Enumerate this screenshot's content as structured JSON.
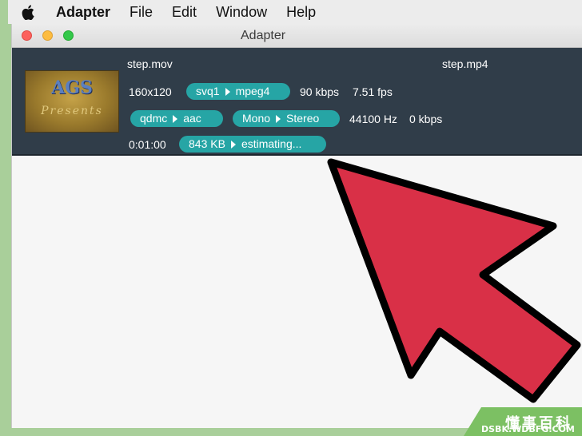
{
  "menubar": {
    "apple_icon": "apple-logo-icon",
    "app_name": "Adapter",
    "items": [
      "File",
      "Edit",
      "Window",
      "Help"
    ]
  },
  "window": {
    "title": "Adapter"
  },
  "job": {
    "thumbnail": {
      "logo_top": "AGS",
      "logo_bottom": "Presents"
    },
    "source_name": "step.mov",
    "output_name": "step.mp4",
    "resolution": "160x120",
    "video_codec": {
      "from": "svq1",
      "to": "mpeg4"
    },
    "video_bitrate": "90 kbps",
    "framerate": "7.51 fps",
    "audio_codec": {
      "from": "qdmc",
      "to": "aac"
    },
    "channels": {
      "from": "Mono",
      "to": "Stereo"
    },
    "sample_rate": "44100 Hz",
    "audio_bitrate": "0 kbps",
    "duration": "0:01:00",
    "size": {
      "from": "843 KB",
      "to": "estimating..."
    }
  },
  "overlay": {
    "arrow_color": "#d93047",
    "arrow_outline": "#000000"
  },
  "watermark": {
    "title": "懂事百科",
    "url": "DSBK.WDBFG.COM"
  },
  "colors": {
    "panel_bg": "#303d49",
    "pill_bg": "#26a5a5",
    "frame_bg": "#a9cf9a"
  }
}
